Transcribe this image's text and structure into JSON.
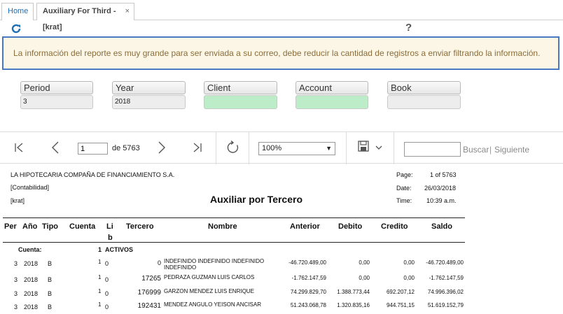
{
  "tabs": {
    "home": "Home",
    "active": "Auxiliary For Third -[krat]",
    "close": "×"
  },
  "help": "?",
  "alert": "La información del reporte es muy grande para ser enviada a su correo, debe reducir la cantidad de registros a enviar filtrando la información.",
  "filters": [
    {
      "label": "Period",
      "value": "3",
      "highlight": false
    },
    {
      "label": "Year",
      "value": "2018",
      "highlight": false
    },
    {
      "label": "Client",
      "value": "",
      "highlight": true
    },
    {
      "label": "Account",
      "value": "",
      "highlight": true
    },
    {
      "label": "Book",
      "value": "",
      "highlight": false
    }
  ],
  "report_toolbar": {
    "page": "1",
    "of": "de 5763",
    "zoom": "100%",
    "search_button": "Buscar",
    "divider": "|",
    "next_button": "Siguiente"
  },
  "report": {
    "company": "LA HIPOTECARIA COMPAÑA DE FINANCIAMIENTO S.A.",
    "subtitle1": "[Contabilidad]",
    "subtitle2": "[krat]",
    "title": "Auxiliar por Tercero",
    "page_label": "Page:",
    "page_value": "1 of 5763",
    "date_label": "Date:",
    "date_value": "26/03/2018",
    "time_label": "Time:",
    "time_value": "10:39 a.m.",
    "columns": [
      "Per",
      "Año",
      "Tipo",
      "Cuenta",
      "Li",
      "b",
      "Tercero",
      "Nombre",
      "Anterior",
      "Debito",
      "Credito",
      "Saldo"
    ],
    "group_label": "Cuenta:",
    "group_code": "1",
    "group_name": "ACTIVOS",
    "rows": [
      {
        "per": "3",
        "year": "2018",
        "tipo": "B",
        "cuenta": "1",
        "lib": "0",
        "tercero": "0",
        "nombre": "INDEFINIDO INDEFINIDO INDEFINIDO",
        "nombre2": "INDEFINIDO",
        "anterior": "-46.720.489,00",
        "debito": "0,00",
        "credito": "0,00",
        "saldo": "-46.720.489,00"
      },
      {
        "per": "3",
        "year": "2018",
        "tipo": "B",
        "cuenta": "1",
        "lib": "0",
        "tercero": "17265",
        "nombre": "PEDRAZA GUZMAN LUIS CARLOS",
        "nombre2": "",
        "anterior": "-1.762.147,59",
        "debito": "0,00",
        "credito": "0,00",
        "saldo": "-1.762.147,59"
      },
      {
        "per": "3",
        "year": "2018",
        "tipo": "B",
        "cuenta": "1",
        "lib": "0",
        "tercero": "176999",
        "nombre": "GARZON MENDEZ LUIS ENRIQUE",
        "nombre2": "",
        "anterior": "74.299.829,70",
        "debito": "1.388.773,44",
        "credito": "692.207,12",
        "saldo": "74.996.396,02"
      },
      {
        "per": "3",
        "year": "2018",
        "tipo": "B",
        "cuenta": "1",
        "lib": "0",
        "tercero": "192431",
        "nombre": "MENDEZ ANGULO YEISON ANCISAR",
        "nombre2": "",
        "anterior": "51.243.068,78",
        "debito": "1.320.835,16",
        "credito": "944.751,15",
        "saldo": "51.619.152,79"
      }
    ]
  }
}
